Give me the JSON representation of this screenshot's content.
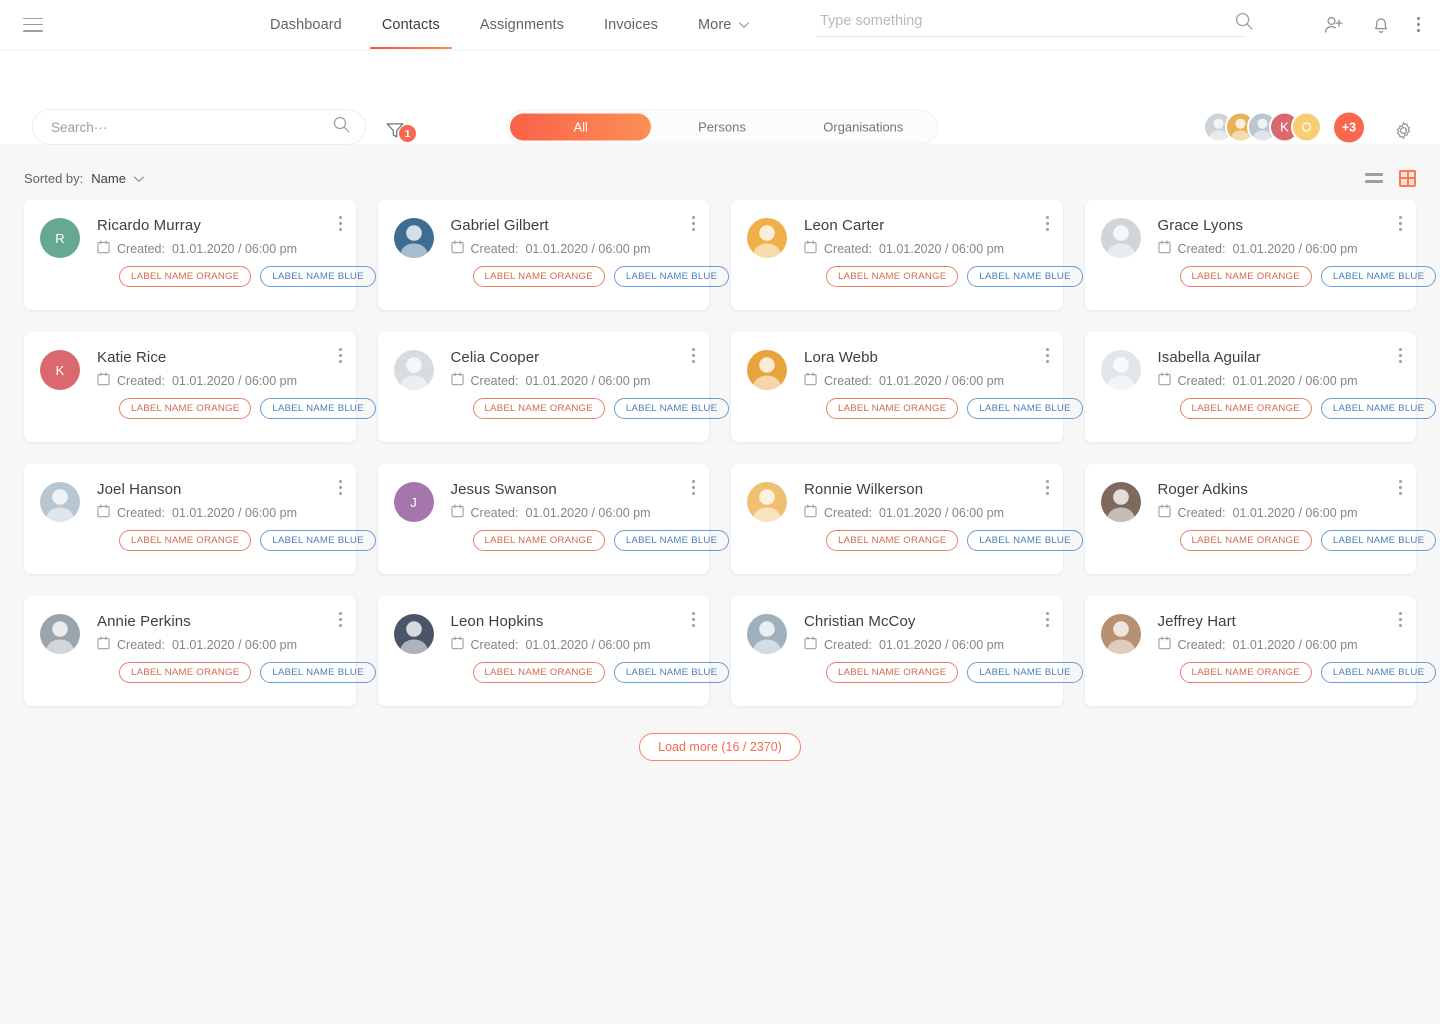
{
  "header": {
    "menu_icon": "hamburger-icon",
    "nav": [
      {
        "label": "Dashboard",
        "active": false,
        "dropdown": false
      },
      {
        "label": "Contacts",
        "active": true,
        "dropdown": false
      },
      {
        "label": "Assignments",
        "active": false,
        "dropdown": false
      },
      {
        "label": "Invoices",
        "active": false,
        "dropdown": false
      },
      {
        "label": "More",
        "active": false,
        "dropdown": true
      }
    ],
    "global_search": {
      "value": "",
      "placeholder": "Type something",
      "icon": "search-icon"
    },
    "icons": [
      "add-user-icon",
      "bell-icon",
      "kebab-menu-icon"
    ]
  },
  "toolbar": {
    "search": {
      "value": "",
      "placeholder": "Search···",
      "icon": "search-icon"
    },
    "filter": {
      "icon": "filter-funnel-icon",
      "badge": "1"
    },
    "segments": [
      {
        "label": "All",
        "active": true
      },
      {
        "label": "Persons",
        "active": false
      },
      {
        "label": "Organisations",
        "active": false
      }
    ],
    "avatars": [
      {
        "type": "photo",
        "tone": "#cdd3d8"
      },
      {
        "type": "photo",
        "tone": "#e7b256"
      },
      {
        "type": "photo",
        "tone": "#bcc6cf"
      },
      {
        "type": "initial",
        "initial": "K",
        "color": "#d9686f"
      },
      {
        "type": "initial",
        "initial": "O",
        "color": "#f7ce72"
      }
    ],
    "overflow_badge": "+3",
    "settings_icon": "gear-icon"
  },
  "sort": {
    "label": "Sorted by:",
    "value": "Name",
    "chevron_icon": "chevron-down-icon",
    "view_list_icon": "list-view-icon",
    "view_grid_icon": "grid-view-icon",
    "active_view": "grid"
  },
  "labels": {
    "orange": "LABEL NAME ORANGE",
    "blue": "LABEL NAME BLUE"
  },
  "created_prefix": "Created:",
  "colors": {
    "accent": "#f9674f",
    "accent_gradient_from": "#fb6149",
    "accent_gradient_to": "#fb9055",
    "label_orange": "#d4694f",
    "label_blue": "#4a7fbd",
    "page_bg": "#f7f7f8"
  },
  "cards": [
    {
      "name": "Ricardo Murray",
      "created": "01.01.2020 / 06:00 pm",
      "avatar": {
        "type": "initial",
        "initial": "R",
        "color": "#66a893"
      }
    },
    {
      "name": "Gabriel Gilbert",
      "created": "01.01.2020 / 06:00 pm",
      "avatar": {
        "type": "photo",
        "tone": "#3d6d93"
      }
    },
    {
      "name": "Leon Carter",
      "created": "01.01.2020 / 06:00 pm",
      "avatar": {
        "type": "photo",
        "tone": "#efb04a"
      }
    },
    {
      "name": "Grace Lyons",
      "created": "01.01.2020 / 06:00 pm",
      "avatar": {
        "type": "photo",
        "tone": "#cfd6db"
      }
    },
    {
      "name": "Katie Rice",
      "created": "01.01.2020 / 06:00 pm",
      "avatar": {
        "type": "initial",
        "initial": "K",
        "color": "#d9686f"
      }
    },
    {
      "name": "Celia Cooper",
      "created": "01.01.2020 / 06:00 pm",
      "avatar": {
        "type": "photo",
        "tone": "#d6dce0"
      }
    },
    {
      "name": "Lora Webb",
      "created": "01.01.2020 / 06:00 pm",
      "avatar": {
        "type": "photo",
        "tone": "#e8a43c"
      }
    },
    {
      "name": "Isabella Aguilar",
      "created": "01.01.2020 / 06:00 pm",
      "avatar": {
        "type": "photo",
        "tone": "#e2e6e9"
      }
    },
    {
      "name": "Joel Hanson",
      "created": "01.01.2020 / 06:00 pm",
      "avatar": {
        "type": "photo",
        "tone": "#b8c6d2"
      }
    },
    {
      "name": "Jesus Swanson",
      "created": "01.01.2020 / 06:00 pm",
      "avatar": {
        "type": "initial",
        "initial": "J",
        "color": "#a476ab"
      }
    },
    {
      "name": "Ronnie Wilkerson",
      "created": "01.01.2020 / 06:00 pm",
      "avatar": {
        "type": "photo",
        "tone": "#f0c071"
      }
    },
    {
      "name": "Roger Adkins",
      "created": "01.01.2020 / 06:00 pm",
      "avatar": {
        "type": "photo",
        "tone": "#7e6a5c"
      }
    },
    {
      "name": "Annie Perkins",
      "created": "01.01.2020 / 06:00 pm",
      "avatar": {
        "type": "photo",
        "tone": "#9aa4ac"
      }
    },
    {
      "name": "Leon Hopkins",
      "created": "01.01.2020 / 06:00 pm",
      "avatar": {
        "type": "photo",
        "tone": "#4a5668"
      }
    },
    {
      "name": "Christian McCoy",
      "created": "01.01.2020 / 06:00 pm",
      "avatar": {
        "type": "photo",
        "tone": "#9fb0bd"
      }
    },
    {
      "name": "Jeffrey Hart",
      "created": "01.01.2020 / 06:00 pm",
      "avatar": {
        "type": "photo",
        "tone": "#b98f71"
      }
    }
  ],
  "load_more": {
    "label": "Load more (16 / 2370)"
  }
}
